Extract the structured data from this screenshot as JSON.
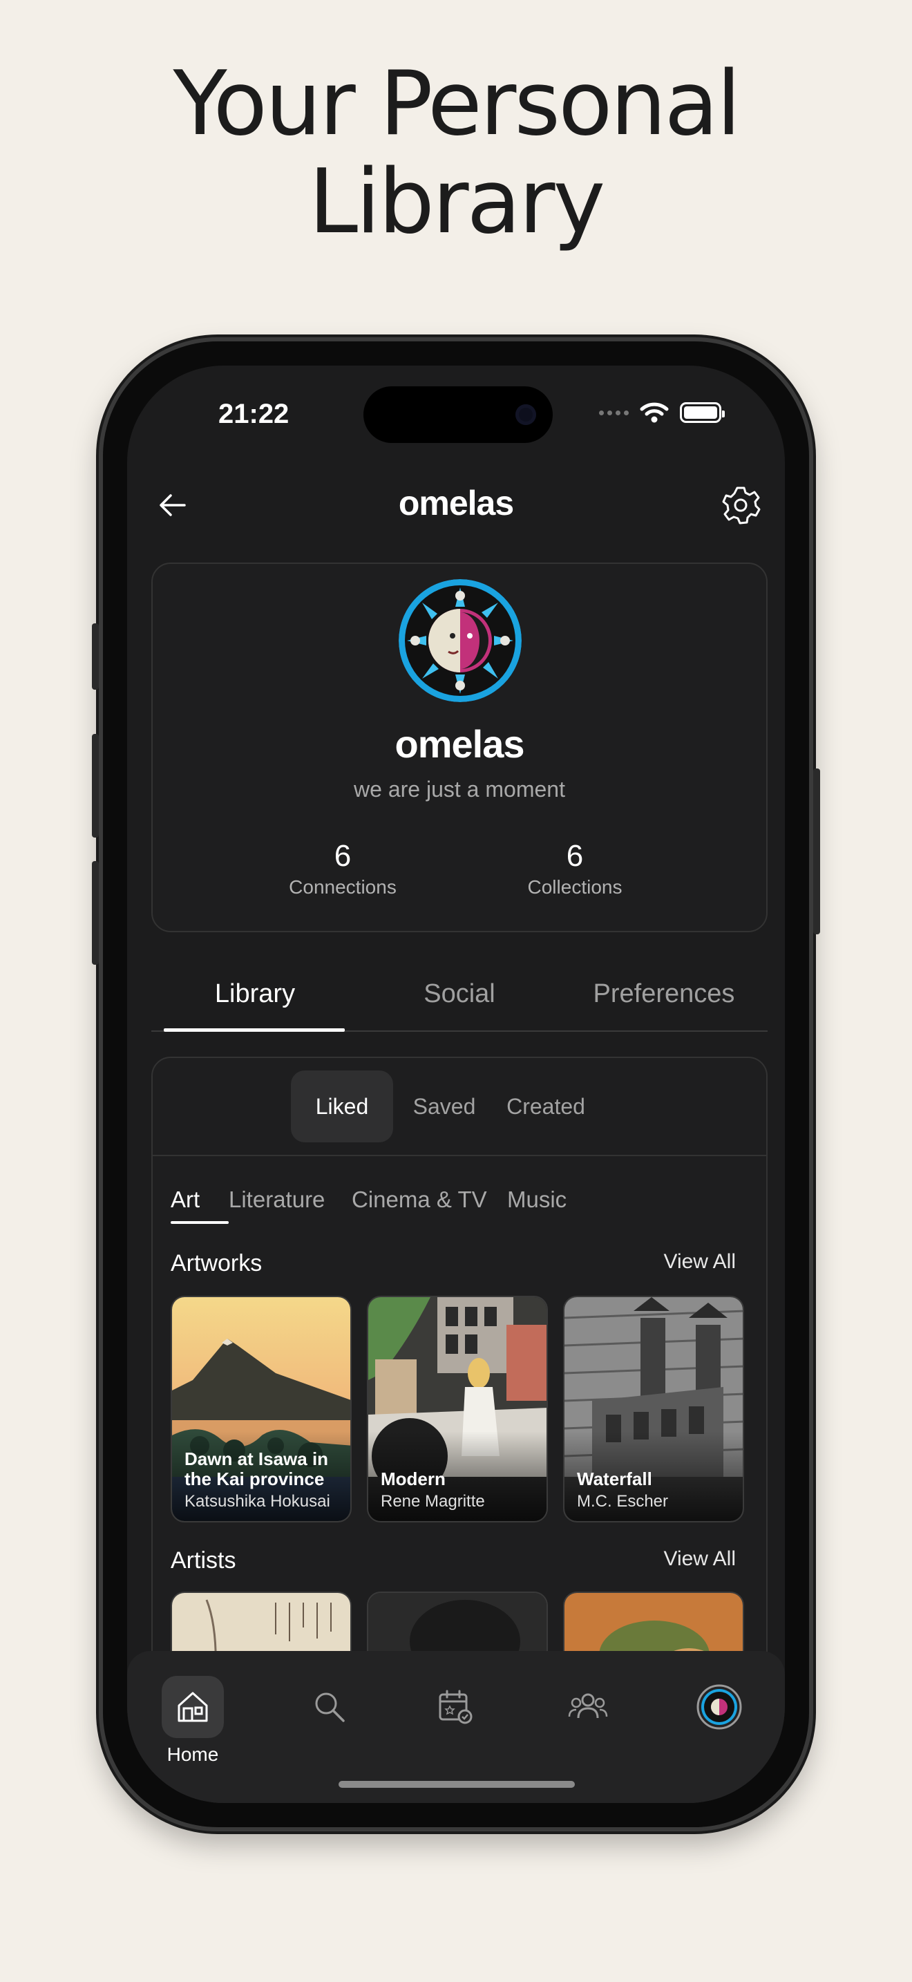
{
  "headline": {
    "line1": "Your Personal",
    "line2": "Library"
  },
  "status_bar": {
    "time": "21:22"
  },
  "nav": {
    "title": "omelas"
  },
  "profile": {
    "name": "omelas",
    "bio": "we are just a moment",
    "stats": [
      {
        "value": "6",
        "label": "Connections"
      },
      {
        "value": "6",
        "label": "Collections"
      }
    ]
  },
  "main_tabs": [
    {
      "label": "Library",
      "active": true
    },
    {
      "label": "Social",
      "active": false
    },
    {
      "label": "Preferences",
      "active": false
    }
  ],
  "segments": [
    {
      "label": "Liked",
      "active": true
    },
    {
      "label": "Saved",
      "active": false
    },
    {
      "label": "Created",
      "active": false
    }
  ],
  "categories": [
    {
      "label": "Art",
      "active": true
    },
    {
      "label": "Literature",
      "active": false
    },
    {
      "label": "Cinema & TV",
      "active": false
    },
    {
      "label": "Music",
      "active": false
    }
  ],
  "artworks": {
    "title": "Artworks",
    "view_all": "View All",
    "items": [
      {
        "title_line1": "Dawn at Isawa in",
        "title_line2": "the Kai province",
        "artist": "Katsushika Hokusai"
      },
      {
        "title_line1": "Modern",
        "title_line2": "",
        "artist": "Rene Magritte"
      },
      {
        "title_line1": "Waterfall",
        "title_line2": "",
        "artist": "M.C. Escher"
      }
    ]
  },
  "artists": {
    "title": "Artists",
    "view_all": "View All"
  },
  "tabbar": {
    "items": [
      {
        "name": "home-icon",
        "label": "Home",
        "active": true
      },
      {
        "name": "search-icon",
        "label": "",
        "active": false
      },
      {
        "name": "calendar-icon",
        "label": "",
        "active": false
      },
      {
        "name": "people-icon",
        "label": "",
        "active": false
      },
      {
        "name": "profile-avatar-icon",
        "label": "",
        "active": false
      }
    ]
  },
  "colors": {
    "background": "#f3efe8",
    "screen": "#1c1c1d",
    "card": "#1e1e1f",
    "text_muted": "#a9a9a9"
  }
}
